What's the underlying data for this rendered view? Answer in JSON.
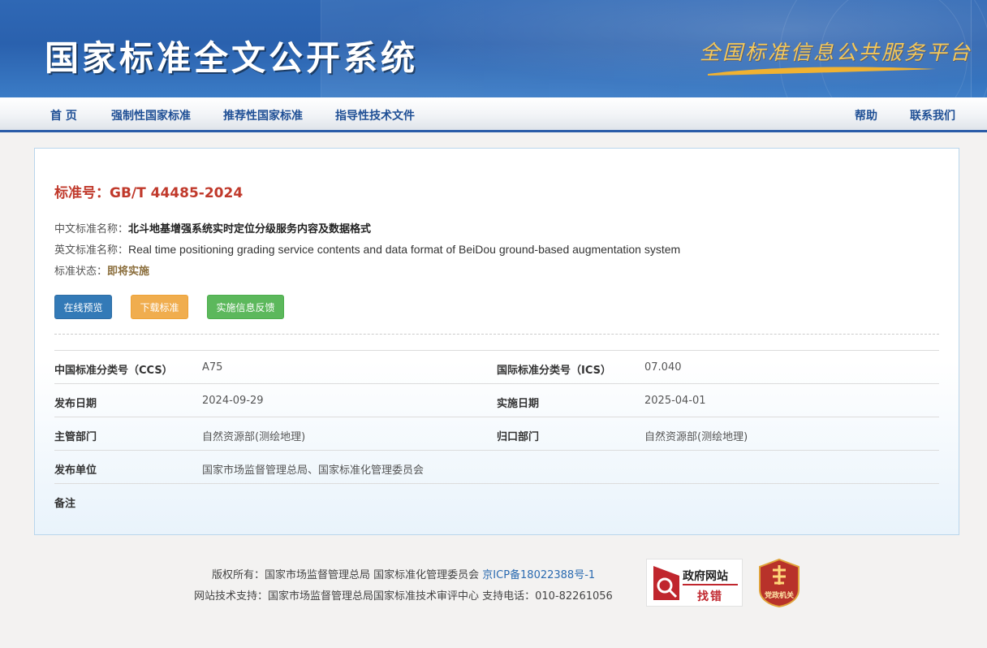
{
  "header": {
    "site_title": "国家标准全文公开系统",
    "slogan": "全国标准信息公共服务平台"
  },
  "nav": {
    "left": [
      "首 页",
      "强制性国家标准",
      "推荐性国家标准",
      "指导性技术文件"
    ],
    "right": [
      "帮助",
      "联系我们"
    ]
  },
  "standard": {
    "title_label": "标准号：",
    "number": "GB/T 44485-2024",
    "cn_name_label": "中文标准名称：",
    "cn_name": "北斗地基增强系统实时定位分级服务内容及数据格式",
    "en_name_label": "英文标准名称：",
    "en_name": "Real time positioning grading service contents and data format of BeiDou ground-based augmentation system",
    "status_label": "标准状态：",
    "status": "即将实施"
  },
  "buttons": {
    "preview": "在线预览",
    "download": "下载标准",
    "feedback": "实施信息反馈"
  },
  "info": [
    {
      "k1": "中国标准分类号（CCS）",
      "v1": "A75",
      "k2": "国际标准分类号（ICS）",
      "v2": "07.040"
    },
    {
      "k1": "发布日期",
      "v1": "2024-09-29",
      "k2": "实施日期",
      "v2": "2025-04-01"
    },
    {
      "k1": "主管部门",
      "v1": "自然资源部(测绘地理)",
      "k2": "归口部门",
      "v2": "自然资源部(测绘地理)"
    },
    {
      "k1": "发布单位",
      "v1": "国家市场监督管理总局、国家标准化管理委员会",
      "k2": "",
      "v2": ""
    },
    {
      "k1": "备注",
      "v1": "",
      "k2": "",
      "v2": ""
    }
  ],
  "footer": {
    "line1": "版权所有：国家市场监督管理总局 国家标准化管理委员会",
    "icp": "京ICP备18022388号-1",
    "line2": "网站技术支持：国家市场监督管理总局国家标准技术审评中心 支持电话：010-82261056",
    "gov_badge_top": "政府网站",
    "gov_badge_bottom": "找错",
    "party_badge": "党政机关"
  },
  "colors": {
    "banner": "#2a61ae",
    "nav_text": "#1f4f95",
    "title_red": "#c0392b",
    "btn_blue": "#337ab7",
    "btn_orange": "#f0ad4e",
    "btn_green": "#5cb85c"
  }
}
